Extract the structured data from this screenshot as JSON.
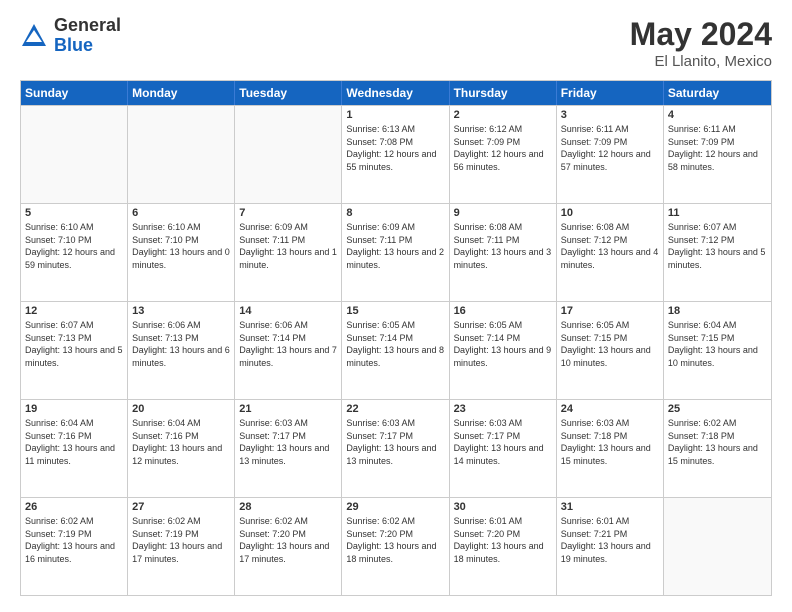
{
  "header": {
    "logo": {
      "general": "General",
      "blue": "Blue"
    },
    "title": "May 2024",
    "location": "El Llanito, Mexico"
  },
  "calendar": {
    "days_of_week": [
      "Sunday",
      "Monday",
      "Tuesday",
      "Wednesday",
      "Thursday",
      "Friday",
      "Saturday"
    ],
    "weeks": [
      [
        {
          "day": "",
          "empty": true
        },
        {
          "day": "",
          "empty": true
        },
        {
          "day": "",
          "empty": true
        },
        {
          "day": "1",
          "sunrise": "6:13 AM",
          "sunset": "7:08 PM",
          "daylight": "12 hours and 55 minutes."
        },
        {
          "day": "2",
          "sunrise": "6:12 AM",
          "sunset": "7:09 PM",
          "daylight": "12 hours and 56 minutes."
        },
        {
          "day": "3",
          "sunrise": "6:11 AM",
          "sunset": "7:09 PM",
          "daylight": "12 hours and 57 minutes."
        },
        {
          "day": "4",
          "sunrise": "6:11 AM",
          "sunset": "7:09 PM",
          "daylight": "12 hours and 58 minutes."
        }
      ],
      [
        {
          "day": "5",
          "sunrise": "6:10 AM",
          "sunset": "7:10 PM",
          "daylight": "12 hours and 59 minutes."
        },
        {
          "day": "6",
          "sunrise": "6:10 AM",
          "sunset": "7:10 PM",
          "daylight": "13 hours and 0 minutes."
        },
        {
          "day": "7",
          "sunrise": "6:09 AM",
          "sunset": "7:11 PM",
          "daylight": "13 hours and 1 minute."
        },
        {
          "day": "8",
          "sunrise": "6:09 AM",
          "sunset": "7:11 PM",
          "daylight": "13 hours and 2 minutes."
        },
        {
          "day": "9",
          "sunrise": "6:08 AM",
          "sunset": "7:11 PM",
          "daylight": "13 hours and 3 minutes."
        },
        {
          "day": "10",
          "sunrise": "6:08 AM",
          "sunset": "7:12 PM",
          "daylight": "13 hours and 4 minutes."
        },
        {
          "day": "11",
          "sunrise": "6:07 AM",
          "sunset": "7:12 PM",
          "daylight": "13 hours and 5 minutes."
        }
      ],
      [
        {
          "day": "12",
          "sunrise": "6:07 AM",
          "sunset": "7:13 PM",
          "daylight": "13 hours and 5 minutes."
        },
        {
          "day": "13",
          "sunrise": "6:06 AM",
          "sunset": "7:13 PM",
          "daylight": "13 hours and 6 minutes."
        },
        {
          "day": "14",
          "sunrise": "6:06 AM",
          "sunset": "7:14 PM",
          "daylight": "13 hours and 7 minutes."
        },
        {
          "day": "15",
          "sunrise": "6:05 AM",
          "sunset": "7:14 PM",
          "daylight": "13 hours and 8 minutes."
        },
        {
          "day": "16",
          "sunrise": "6:05 AM",
          "sunset": "7:14 PM",
          "daylight": "13 hours and 9 minutes."
        },
        {
          "day": "17",
          "sunrise": "6:05 AM",
          "sunset": "7:15 PM",
          "daylight": "13 hours and 10 minutes."
        },
        {
          "day": "18",
          "sunrise": "6:04 AM",
          "sunset": "7:15 PM",
          "daylight": "13 hours and 10 minutes."
        }
      ],
      [
        {
          "day": "19",
          "sunrise": "6:04 AM",
          "sunset": "7:16 PM",
          "daylight": "13 hours and 11 minutes."
        },
        {
          "day": "20",
          "sunrise": "6:04 AM",
          "sunset": "7:16 PM",
          "daylight": "13 hours and 12 minutes."
        },
        {
          "day": "21",
          "sunrise": "6:03 AM",
          "sunset": "7:17 PM",
          "daylight": "13 hours and 13 minutes."
        },
        {
          "day": "22",
          "sunrise": "6:03 AM",
          "sunset": "7:17 PM",
          "daylight": "13 hours and 13 minutes."
        },
        {
          "day": "23",
          "sunrise": "6:03 AM",
          "sunset": "7:17 PM",
          "daylight": "13 hours and 14 minutes."
        },
        {
          "day": "24",
          "sunrise": "6:03 AM",
          "sunset": "7:18 PM",
          "daylight": "13 hours and 15 minutes."
        },
        {
          "day": "25",
          "sunrise": "6:02 AM",
          "sunset": "7:18 PM",
          "daylight": "13 hours and 15 minutes."
        }
      ],
      [
        {
          "day": "26",
          "sunrise": "6:02 AM",
          "sunset": "7:19 PM",
          "daylight": "13 hours and 16 minutes."
        },
        {
          "day": "27",
          "sunrise": "6:02 AM",
          "sunset": "7:19 PM",
          "daylight": "13 hours and 17 minutes."
        },
        {
          "day": "28",
          "sunrise": "6:02 AM",
          "sunset": "7:20 PM",
          "daylight": "13 hours and 17 minutes."
        },
        {
          "day": "29",
          "sunrise": "6:02 AM",
          "sunset": "7:20 PM",
          "daylight": "13 hours and 18 minutes."
        },
        {
          "day": "30",
          "sunrise": "6:01 AM",
          "sunset": "7:20 PM",
          "daylight": "13 hours and 18 minutes."
        },
        {
          "day": "31",
          "sunrise": "6:01 AM",
          "sunset": "7:21 PM",
          "daylight": "13 hours and 19 minutes."
        },
        {
          "day": "",
          "empty": true
        }
      ]
    ]
  }
}
